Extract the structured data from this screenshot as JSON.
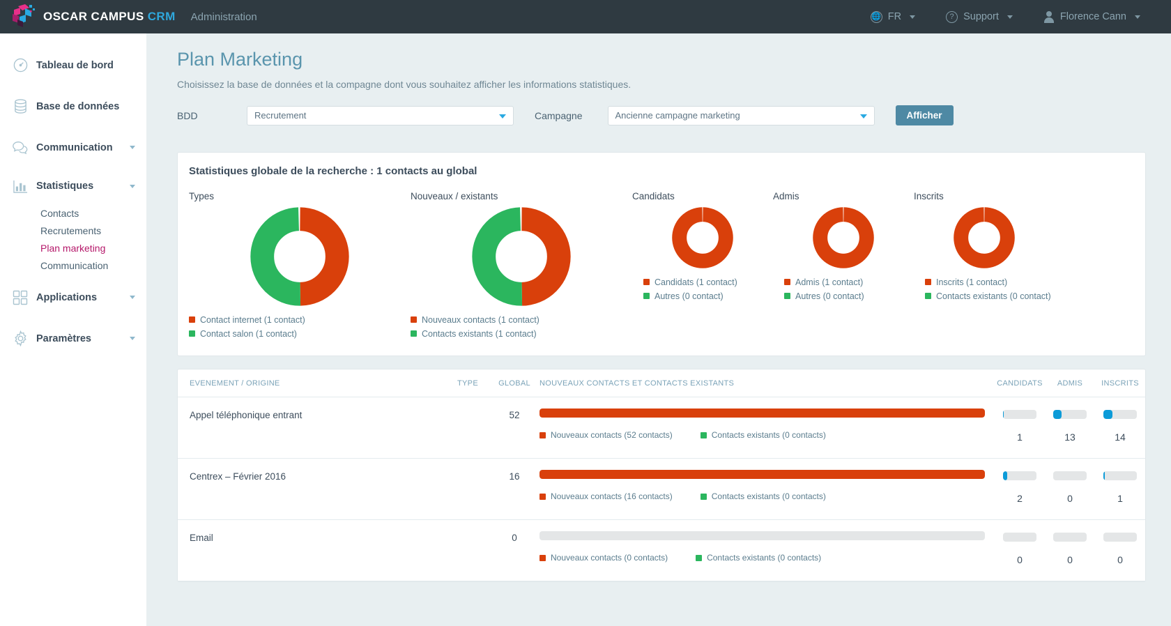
{
  "colors": {
    "orange": "#d9400b",
    "green": "#2bb65e",
    "blue": "#0c9bd8",
    "accent_brand": "#2fa8dd",
    "active_nav": "#b5186a",
    "topbar_bg": "#2f3a41",
    "page_bg": "#e8eff1",
    "button": "#4e89a4"
  },
  "topbar": {
    "brand_main": "OSCAR CAMPUS ",
    "brand_accent": "CRM",
    "section": "Administration",
    "language": "FR",
    "support": "Support",
    "user": "Florence Cann"
  },
  "sidebar": {
    "items": [
      {
        "label": "Tableau de bord",
        "icon": "dashboard-icon",
        "caret": false
      },
      {
        "label": "Base de données",
        "icon": "database-icon",
        "caret": false
      },
      {
        "label": "Communication",
        "icon": "chat-icon",
        "caret": true
      },
      {
        "label": "Statistiques",
        "icon": "bar-chart-icon",
        "caret": true
      },
      {
        "label": "Applications",
        "icon": "grid-icon",
        "caret": true
      },
      {
        "label": "Paramètres",
        "icon": "gear-icon",
        "caret": true
      }
    ],
    "statistiques_sub": [
      {
        "label": "Contacts",
        "active": false
      },
      {
        "label": "Recrutements",
        "active": false
      },
      {
        "label": "Plan marketing",
        "active": true
      },
      {
        "label": "Communication",
        "active": false
      }
    ]
  },
  "page": {
    "title": "Plan Marketing",
    "subtitle": "Choisissez la base de données et la compagne dont vous souhaitez afficher les informations statistiques."
  },
  "form": {
    "bdd_label": "BDD",
    "bdd_value": "Recrutement",
    "campagne_label": "Campagne",
    "campagne_value": "Ancienne campagne marketing",
    "submit_label": "Afficher"
  },
  "stats_card": {
    "title": "Statistiques globale de la recherche : 1 contacts au global"
  },
  "chart_data": [
    {
      "type": "pie",
      "variant": "donut",
      "title": "Types",
      "labels": [
        "Contact internet",
        "Contact salon"
      ],
      "values": [
        1,
        1
      ],
      "colors": [
        "#d9400b",
        "#2bb65e"
      ],
      "legend": [
        "Contact internet (1 contact)",
        "Contact salon (1 contact)"
      ],
      "legend_position": "bottom",
      "size": "large"
    },
    {
      "type": "pie",
      "variant": "donut",
      "title": "Nouveaux / existants",
      "labels": [
        "Nouveaux contacts",
        "Contacts existants"
      ],
      "values": [
        1,
        1
      ],
      "colors": [
        "#d9400b",
        "#2bb65e"
      ],
      "legend": [
        "Nouveaux contacts (1 contact)",
        "Contacts existants (1 contact)"
      ],
      "legend_position": "bottom",
      "size": "large"
    },
    {
      "type": "pie",
      "variant": "donut",
      "title": "Candidats",
      "labels": [
        "Candidats",
        "Autres"
      ],
      "values": [
        1,
        0
      ],
      "colors": [
        "#d9400b",
        "#2bb65e"
      ],
      "legend": [
        "Candidats (1 contact)",
        "Autres (0 contact)"
      ],
      "legend_position": "bottom",
      "size": "small"
    },
    {
      "type": "pie",
      "variant": "donut",
      "title": "Admis",
      "labels": [
        "Admis",
        "Autres"
      ],
      "values": [
        1,
        0
      ],
      "colors": [
        "#d9400b",
        "#2bb65e"
      ],
      "legend": [
        "Admis (1 contact)",
        "Autres (0 contact)"
      ],
      "legend_position": "bottom",
      "size": "small"
    },
    {
      "type": "pie",
      "variant": "donut",
      "title": "Inscrits",
      "labels": [
        "Inscrits",
        "Contacts existants"
      ],
      "values": [
        1,
        0
      ],
      "colors": [
        "#d9400b",
        "#2bb65e"
      ],
      "legend": [
        "Inscrits (1 contact)",
        "Contacts existants (0 contact)"
      ],
      "legend_position": "bottom",
      "size": "small"
    },
    {
      "type": "table",
      "title": "Evenement / origine breakdown",
      "columns": [
        "EVENEMENT / ORIGINE",
        "TYPE",
        "GLOBAL",
        "NOUVEAUX CONTACTS ET CONTACTS EXISTANTS",
        "CANDIDATS",
        "ADMIS",
        "INSCRITS"
      ],
      "rows": [
        {
          "origin": "Appel téléphonique entrant",
          "type": "",
          "global": "52",
          "mix_fill_pct": 100,
          "mix_legend": [
            "Nouveaux contacts (52 contacts)",
            "Contacts existants (0 contacts)"
          ],
          "candidats": "1",
          "candidats_pct": 2,
          "admis": "13",
          "admis_pct": 25,
          "inscrits": "14",
          "inscrits_pct": 27
        },
        {
          "origin": "Centrex – Février 2016",
          "type": "",
          "global": "16",
          "mix_fill_pct": 100,
          "mix_legend": [
            "Nouveaux contacts (16 contacts)",
            "Contacts existants (0 contacts)"
          ],
          "candidats": "2",
          "candidats_pct": 13,
          "admis": "0",
          "admis_pct": 0,
          "inscrits": "1",
          "inscrits_pct": 5
        },
        {
          "origin": "Email",
          "type": "",
          "global": "0",
          "mix_fill_pct": 0,
          "mix_legend": [
            "Nouveaux contacts (0 contacts)",
            "Contacts existants (0 contacts)"
          ],
          "candidats": "0",
          "candidats_pct": 0,
          "admis": "0",
          "admis_pct": 0,
          "inscrits": "0",
          "inscrits_pct": 0
        }
      ]
    }
  ]
}
